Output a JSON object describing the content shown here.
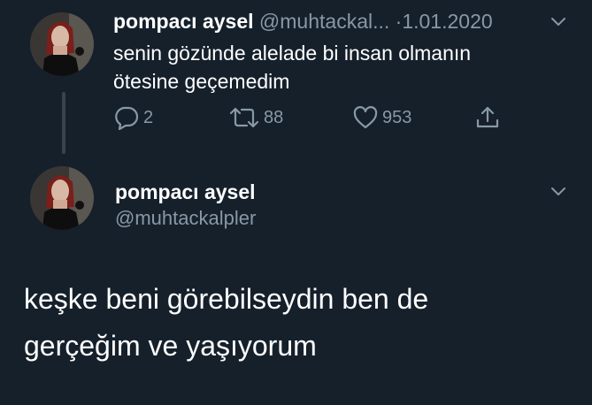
{
  "tweet1": {
    "avatar_alt": "profile photo",
    "display_name": "pompacı aysel",
    "handle": "@muhtackal...",
    "separator": "·",
    "date": "1.01.2020",
    "text_lines": [
      "senin gözünde alelade bi insan olmanın",
      "ötesine geçemedim"
    ],
    "actions": {
      "reply_count": "2",
      "retweet_count": "88",
      "like_count": "953"
    }
  },
  "tweet2": {
    "display_name": "pompacı aysel",
    "handle": "@muhtackalpler",
    "text_lines": [
      "keşke beni görebilseydin ben de",
      "gerçeğim ve yaşıyorum"
    ]
  },
  "icons": {
    "reply": "speech-bubble",
    "retweet": "retweet-arrows",
    "like": "heart-outline",
    "share": "share-upload",
    "more": "chevron-down"
  },
  "colors": {
    "background": "#15202b",
    "primary_text": "#ffffff",
    "secondary_text": "#8899a6",
    "thread_line": "#38444d"
  }
}
